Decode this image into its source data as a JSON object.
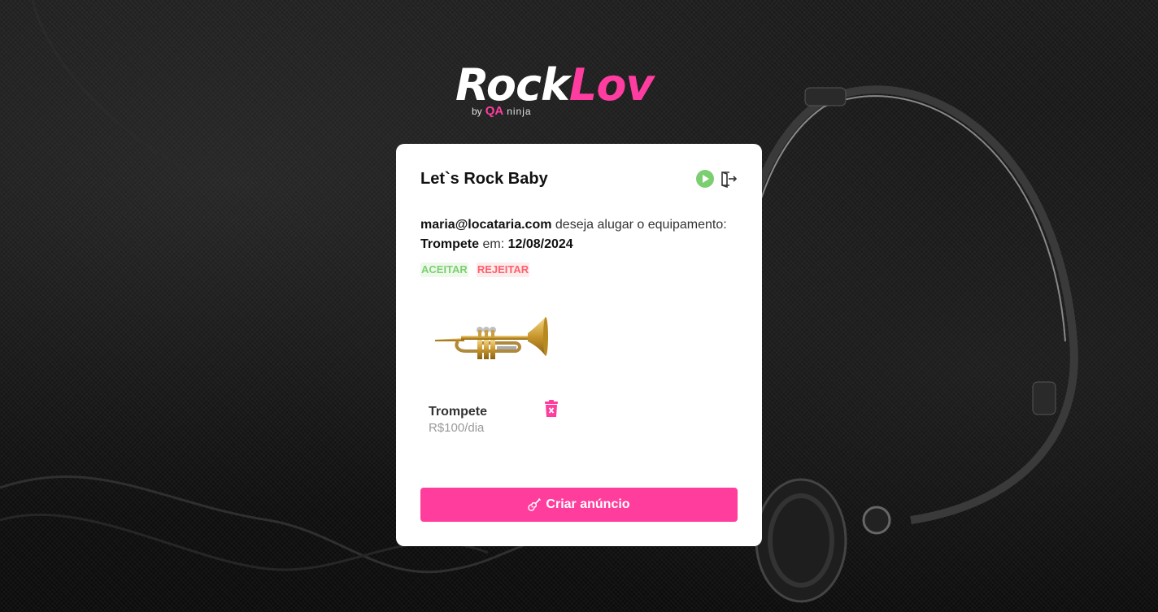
{
  "brand": {
    "word_part1": "Rock",
    "word_part2": "Lov",
    "by": "by",
    "qa": "QA",
    "ninja": "ninja",
    "accent_color": "#ff3da0"
  },
  "card": {
    "title": "Let`s Rock Baby",
    "icons": [
      "play-icon",
      "logout-icon"
    ],
    "request": {
      "email": "maria@locataria.com",
      "text": " deseja alugar o equipamento:",
      "equipment": "Trompete",
      "em_label": " em: ",
      "date": "12/08/2024"
    },
    "accept_label": "ACEITAR",
    "reject_label": "REJEITAR",
    "equipment_item": {
      "name": "Trompete",
      "price": "R$100/dia",
      "image_icon": "trumpet-image"
    },
    "create_button_label": "Criar anúncio"
  },
  "colors": {
    "primary": "#ff3d9c",
    "accept": "#7ccf71",
    "reject": "#ff5f6d"
  }
}
